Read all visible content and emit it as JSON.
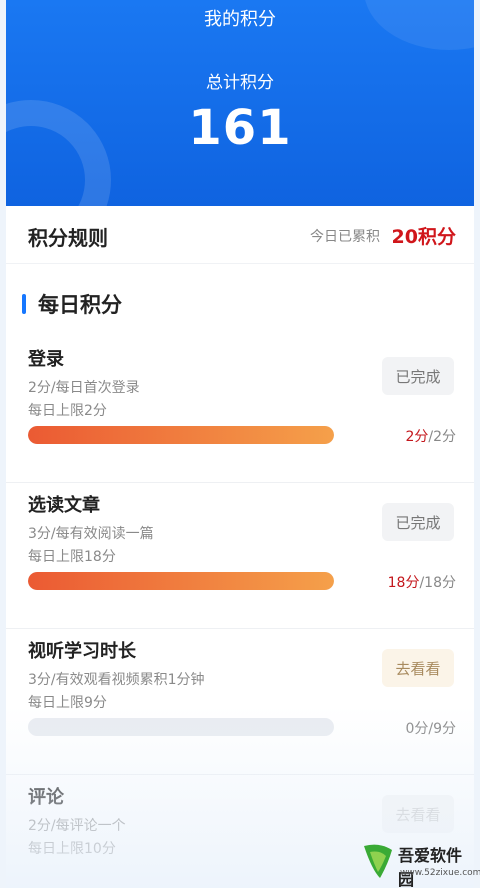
{
  "header": {
    "title": "我的积分",
    "total_label": "总计积分",
    "total_value": "161"
  },
  "rules": {
    "title": "积分规则",
    "today_label": "今日已累积",
    "today_value": "20积分"
  },
  "section": {
    "title": "每日积分"
  },
  "tasks": [
    {
      "name": "登录",
      "desc": "2分/每日首次登录",
      "limit": "每日上限2分",
      "button": "已完成",
      "current": "2分",
      "max": "/2分",
      "progress": 1.0
    },
    {
      "name": "选读文章",
      "desc": "3分/每有效阅读一篇",
      "limit": "每日上限18分",
      "button": "已完成",
      "current": "18分",
      "max": "/18分",
      "progress": 1.0
    },
    {
      "name": "视听学习时长",
      "desc": "3分/有效观看视频累积1分钟",
      "limit": "每日上限9分",
      "button": "去看看",
      "current": "0分",
      "max": "/9分",
      "progress": 0.0
    },
    {
      "name": "评论",
      "desc": "2分/每评论一个",
      "limit": "每日上限10分",
      "button": "去看看",
      "progress": 0.0
    }
  ],
  "watermark": {
    "text": "吾爱软件园",
    "url": "www.52zixue.com"
  },
  "colors": {
    "primary": "#1677ff",
    "accent_red": "#d0161b",
    "progress_start": "#eb5a33",
    "progress_end": "#f5a04a"
  }
}
